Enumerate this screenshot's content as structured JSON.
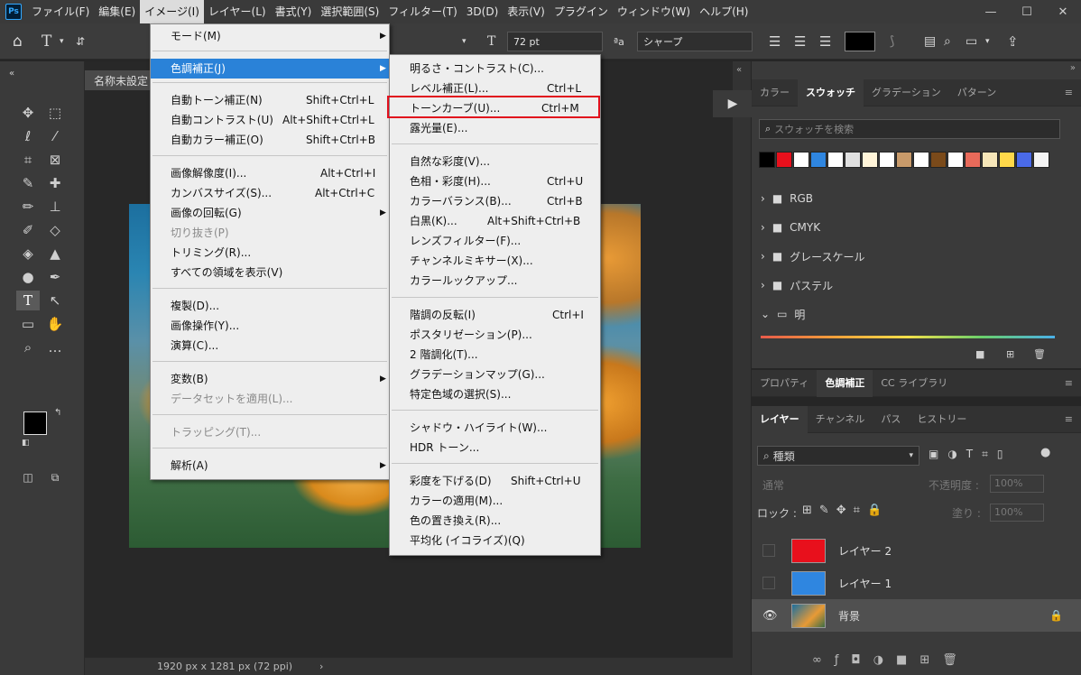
{
  "menubar": {
    "logo": "Ps",
    "items": [
      "ファイル(F)",
      "編集(E)",
      "イメージ(I)",
      "レイヤー(L)",
      "書式(Y)",
      "選択範囲(S)",
      "フィルター(T)",
      "3D(D)",
      "表示(V)",
      "プラグイン",
      "ウィンドウ(W)",
      "ヘルプ(H)"
    ],
    "window_controls": [
      "—",
      "☐",
      "✕"
    ]
  },
  "options_bar": {
    "font_size": "72 pt",
    "antialias": "シャープ"
  },
  "document": {
    "tab_title": "名称未設定",
    "status": "1920 px x 1281 px (72 ppi)"
  },
  "image_menu": [
    {
      "label": "モード(M)",
      "submenu": true
    },
    {
      "label": "色調補正(J)",
      "submenu": true,
      "highlighted": true
    },
    {
      "label": "自動トーン補正(N)",
      "shortcut": "Shift+Ctrl+L"
    },
    {
      "label": "自動コントラスト(U)",
      "shortcut": "Alt+Shift+Ctrl+L"
    },
    {
      "label": "自動カラー補正(O)",
      "shortcut": "Shift+Ctrl+B"
    },
    {
      "label": "画像解像度(I)...",
      "shortcut": "Alt+Ctrl+I"
    },
    {
      "label": "カンバスサイズ(S)...",
      "shortcut": "Alt+Ctrl+C"
    },
    {
      "label": "画像の回転(G)",
      "submenu": true
    },
    {
      "label": "切り抜き(P)",
      "disabled": true
    },
    {
      "label": "トリミング(R)..."
    },
    {
      "label": "すべての領域を表示(V)"
    },
    {
      "label": "複製(D)..."
    },
    {
      "label": "画像操作(Y)..."
    },
    {
      "label": "演算(C)..."
    },
    {
      "label": "変数(B)",
      "submenu": true
    },
    {
      "label": "データセットを適用(L)...",
      "disabled": true
    },
    {
      "label": "トラッピング(T)...",
      "disabled": true
    },
    {
      "label": "解析(A)",
      "submenu": true
    }
  ],
  "adjust_menu": [
    {
      "label": "明るさ・コントラスト(C)..."
    },
    {
      "label": "レベル補正(L)...",
      "shortcut": "Ctrl+L"
    },
    {
      "label": "トーンカーブ(U)...",
      "shortcut": "Ctrl+M",
      "outlined": true
    },
    {
      "label": "露光量(E)..."
    },
    {
      "label": "自然な彩度(V)..."
    },
    {
      "label": "色相・彩度(H)...",
      "shortcut": "Ctrl+U"
    },
    {
      "label": "カラーバランス(B)...",
      "shortcut": "Ctrl+B"
    },
    {
      "label": "白黒(K)...",
      "shortcut": "Alt+Shift+Ctrl+B"
    },
    {
      "label": "レンズフィルター(F)..."
    },
    {
      "label": "チャンネルミキサー(X)..."
    },
    {
      "label": "カラールックアップ..."
    },
    {
      "label": "階調の反転(I)",
      "shortcut": "Ctrl+I"
    },
    {
      "label": "ポスタリゼーション(P)..."
    },
    {
      "label": "2 階調化(T)..."
    },
    {
      "label": "グラデーションマップ(G)..."
    },
    {
      "label": "特定色域の選択(S)..."
    },
    {
      "label": "シャドウ・ハイライト(W)..."
    },
    {
      "label": "HDR トーン..."
    },
    {
      "label": "彩度を下げる(D)",
      "shortcut": "Shift+Ctrl+U"
    },
    {
      "label": "カラーの適用(M)..."
    },
    {
      "label": "色の置き換え(R)..."
    },
    {
      "label": "平均化 (イコライズ)(Q)"
    }
  ],
  "swatches_panel": {
    "tabs": [
      "カラー",
      "スウォッチ",
      "グラデーション",
      "パターン"
    ],
    "search_placeholder": "スウォッチを検索",
    "colors": [
      "#000000",
      "#e8101c",
      "#ffffff",
      "#2f86e0",
      "#ffffff",
      "#e0e0e0",
      "#fff4d8",
      "#ffffff",
      "#c89a6a",
      "#ffffff",
      "#7a4a1a",
      "#ffffff",
      "#e86a5a",
      "#f6e6b8",
      "#ffd84a",
      "#4a6ae8",
      "#f4f4f4"
    ],
    "folders": [
      "RGB",
      "CMYK",
      "グレースケール",
      "パステル",
      "明"
    ]
  },
  "properties_panel": {
    "tabs": [
      "プロパティ",
      "色調補正",
      "CC ライブラリ"
    ]
  },
  "layers_panel": {
    "tabs": [
      "レイヤー",
      "チャンネル",
      "パス",
      "ヒストリー"
    ],
    "filter_label": "種類",
    "blend_mode": "通常",
    "opacity_label": "不透明度 :",
    "opacity_value": "100%",
    "lock_label": "ロック :",
    "fill_label": "塗り :",
    "fill_value": "100%",
    "layers": [
      {
        "name": "レイヤー 2",
        "color": "#e8101c"
      },
      {
        "name": "レイヤー 1",
        "color": "#2f86e0"
      },
      {
        "name": "背景",
        "visible": true,
        "locked": true
      }
    ]
  }
}
